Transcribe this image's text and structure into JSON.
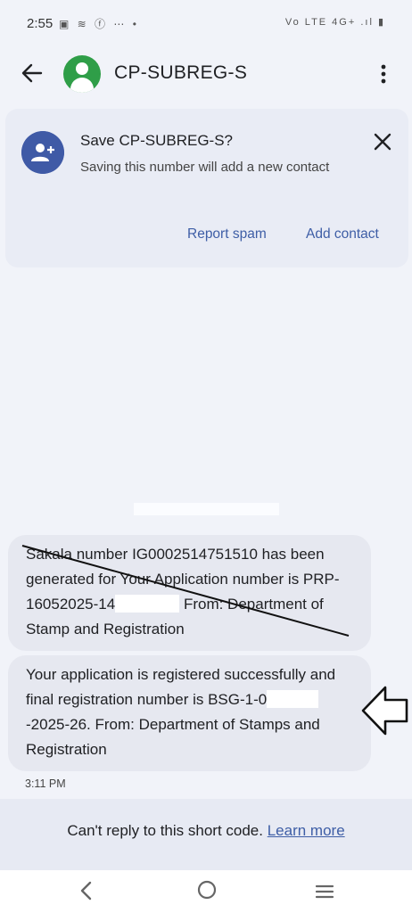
{
  "status_bar": {
    "time": "2:55",
    "left_icons": "▣ ≋ ⓕ ⋯ •",
    "right_icons": "Vo LTE 4G+ .ıl ▮"
  },
  "header": {
    "contact_name": "CP-SUBREG-S",
    "avatar_color": "#2f9e48"
  },
  "save_prompt": {
    "title": "Save CP-SUBREG-S?",
    "description": "Saving this number will add a new contact",
    "report_spam_label": "Report spam",
    "add_contact_label": "Add contact"
  },
  "messages": [
    {
      "part1": "Sakala number IG0002514751510 has been generated for Your Application number is PRP-16052025-14",
      "part2": " From: Department of Stamp and Registration",
      "struck_through": true
    },
    {
      "part1": "Your application is registered successfully and final registration number is BSG-1-0",
      "part2": "-2025-26. From: Department of Stamps and Registration",
      "struck_through": false
    }
  ],
  "message_time": "3:11 PM",
  "reply_bar": {
    "text": "Can't reply to this short code.",
    "link_label": "Learn more"
  },
  "icons": {
    "back": "arrow-left-icon",
    "more": "more-vert-icon",
    "add_person": "person-add-icon",
    "close": "close-icon",
    "annotation": "arrow-left-outline-icon",
    "nav_back": "chevron-left-icon",
    "nav_home": "circle-icon",
    "nav_recent": "menu-lines-icon"
  },
  "colors": {
    "accent": "#3e5ea6",
    "background": "#f1f3f9",
    "bubble": "#e6e8f0"
  }
}
